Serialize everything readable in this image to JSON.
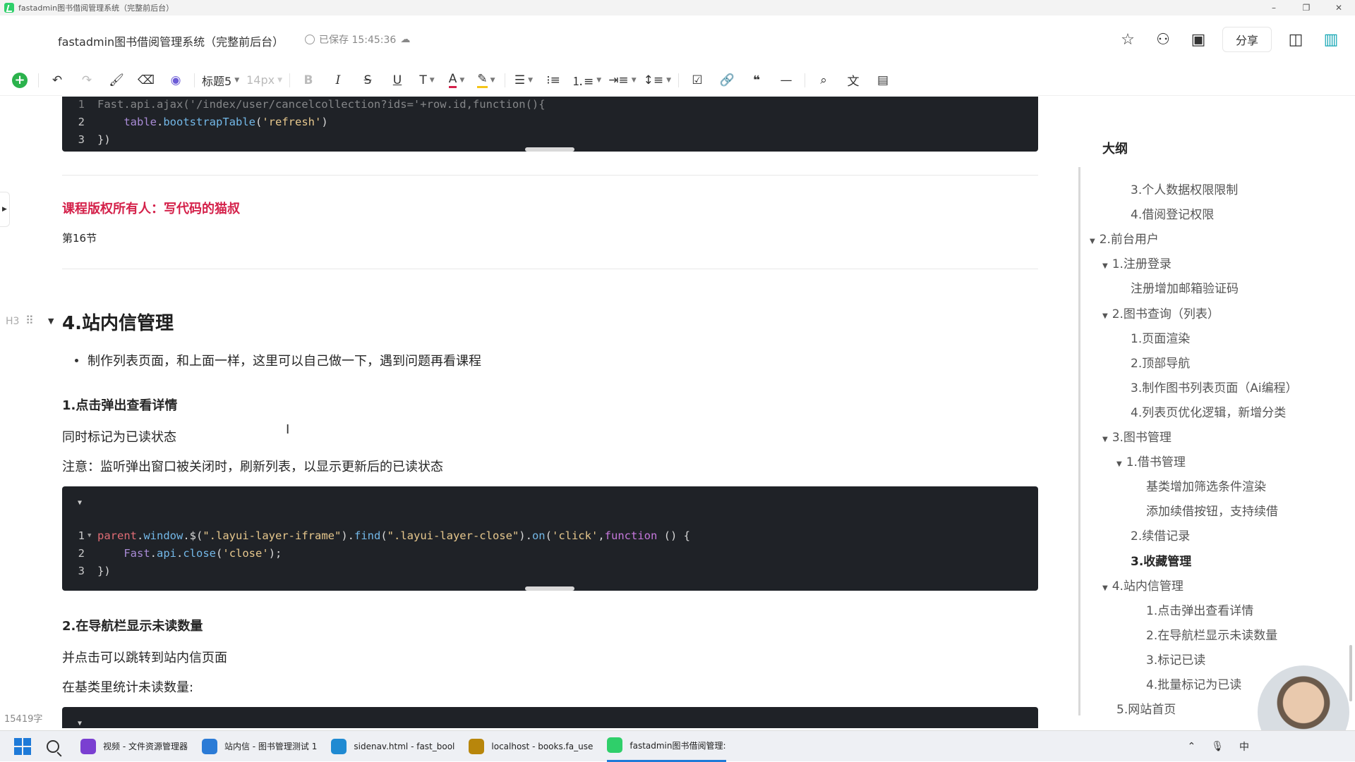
{
  "window": {
    "title": "fastadmin图书借阅管理系统（完整前后台）",
    "controls": [
      "–",
      "❐",
      "✕"
    ]
  },
  "header": {
    "doc_title": "fastadmin图书借阅管理系统（完整前后台）",
    "save_status": "已保存 15:45:36",
    "share_label": "分享"
  },
  "toolbar": {
    "heading_style": "标题5",
    "font_size": "14px"
  },
  "code_block_1": {
    "lines": [
      {
        "num": "1",
        "text": "Fast.api.ajax('/index/user/cancelcollection?ids='+row.id,function(){"
      },
      {
        "num": "2",
        "indent": "    ",
        "obj": "table",
        "method": "bootstrapTable",
        "arg": "'refresh'"
      },
      {
        "num": "3",
        "text": "})"
      }
    ]
  },
  "content": {
    "copyright": "课程版权所有人：写代码的猫叔",
    "section_no": "第16节",
    "h3_marker": "H3",
    "heading": "4.站内信管理",
    "bullet_text": "制作列表页面，和上面一样，这里可以自己做一下，遇到问题再看课程",
    "sub1_title": "1.点击弹出查看详情",
    "sub1_p1": "同时标记为已读状态",
    "sub1_p2": "注意：监听弹出窗口被关闭时，刷新列表，以显示更新后的已读状态",
    "sub2_title": "2.在导航栏显示未读数量",
    "sub2_p1": "并点击可以跳转到站内信页面",
    "sub2_p2": "在基类里统计未读数量:",
    "word_count": "15419字"
  },
  "code_block_2": {
    "line1": {
      "num": "1",
      "a": "parent",
      "b": ".",
      "c": "window",
      "d": ".$(",
      "e": "\".layui-layer-iframe\"",
      "f": ").",
      "g": "find",
      "h": "(",
      "i": "\".layui-layer-close\"",
      "j": ").",
      "k": "on",
      "l": "(",
      "m": "'click'",
      "n": ",",
      "o": "function",
      "p": " () {"
    },
    "line2": {
      "num": "2",
      "a": "    Fast",
      "b": ".",
      "c": "api",
      "d": ".",
      "e": "close",
      "f": "(",
      "g": "'close'",
      "h": ");"
    },
    "line3": {
      "num": "3",
      "a": "})"
    }
  },
  "outline": {
    "title": "大纲",
    "items": [
      {
        "label": "3.个人数据权限限制",
        "level": 3,
        "caret": false,
        "active": false
      },
      {
        "label": "4.借阅登记权限",
        "level": 3,
        "caret": false,
        "active": false
      },
      {
        "label": "2.前台用户",
        "level": 1,
        "caret": true,
        "active": false
      },
      {
        "label": "1.注册登录",
        "level": 2,
        "caret": true,
        "active": false
      },
      {
        "label": "注册增加邮箱验证码",
        "level": 3,
        "caret": false,
        "active": false
      },
      {
        "label": "2.图书查询（列表）",
        "level": 2,
        "caret": true,
        "active": false
      },
      {
        "label": "1.页面渲染",
        "level": 3,
        "caret": false,
        "active": false
      },
      {
        "label": "2.顶部导航",
        "level": 3,
        "caret": false,
        "active": false
      },
      {
        "label": "3.制作图书列表页面（Ai编程）",
        "level": 3,
        "caret": false,
        "active": false
      },
      {
        "label": "4.列表页优化逻辑，新增分类",
        "level": 3,
        "caret": false,
        "active": false
      },
      {
        "label": "3.图书管理",
        "level": 2,
        "caret": true,
        "active": false
      },
      {
        "label": "1.借书管理",
        "level": 3,
        "caret": true,
        "active": false
      },
      {
        "label": "基类增加筛选条件渲染",
        "level": 4,
        "caret": false,
        "active": false
      },
      {
        "label": "添加续借按钮，支持续借",
        "level": 4,
        "caret": false,
        "active": false
      },
      {
        "label": "2.续借记录",
        "level": 3,
        "caret": false,
        "active": false
      },
      {
        "label": "3.收藏管理",
        "level": 3,
        "caret": false,
        "active": true
      },
      {
        "label": "4.站内信管理",
        "level": 2,
        "caret": true,
        "active": false
      },
      {
        "label": "1.点击弹出查看详情",
        "level": 4,
        "caret": false,
        "active": false
      },
      {
        "label": "2.在导航栏显示未读数量",
        "level": 4,
        "caret": false,
        "active": false
      },
      {
        "label": "3.标记已读",
        "level": 4,
        "caret": false,
        "active": false
      },
      {
        "label": "4.批量标记为已读",
        "level": 4,
        "caret": false,
        "active": false
      },
      {
        "label": "5.网站首页",
        "level": 2,
        "caret": false,
        "active": false
      }
    ]
  },
  "taskbar": {
    "apps": [
      {
        "label": "视频 - 文件资源管理器",
        "color": "#7a3fd1"
      },
      {
        "label": "站内信 - 图书管理测试 1",
        "color": "#2b7bd6"
      },
      {
        "label": "sidenav.html - fast_bool",
        "color": "#1f8ad2"
      },
      {
        "label": "localhost - books.fa_use",
        "color": "#b8860b"
      },
      {
        "label": "fastadmin图书借阅管理:",
        "color": "#2fcf6a"
      }
    ],
    "tray_ime": "中"
  }
}
